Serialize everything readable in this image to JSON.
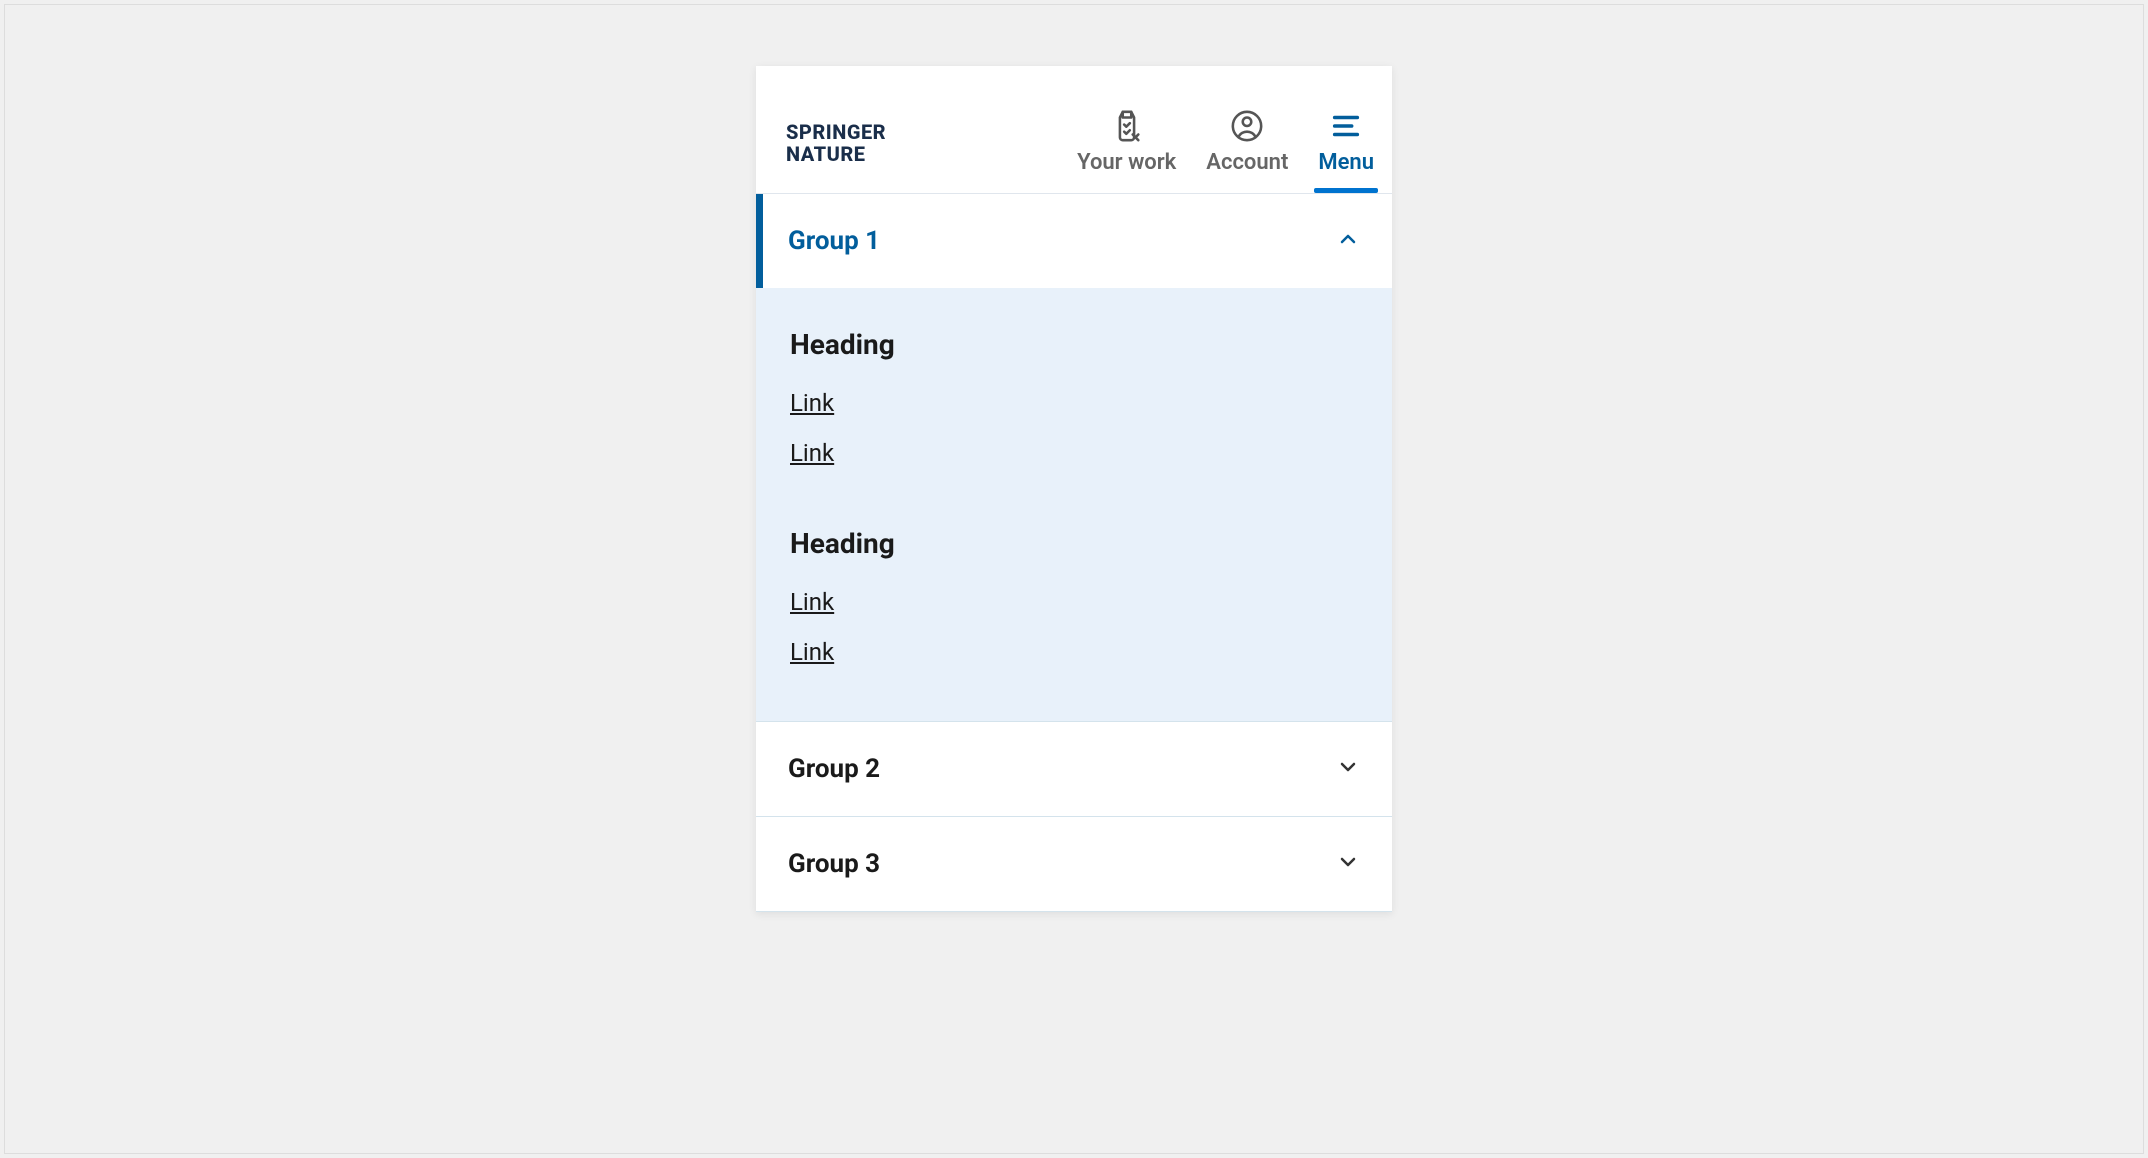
{
  "brand": {
    "line1": "Springer",
    "line2": "Nature"
  },
  "header": {
    "items": [
      {
        "label": "Your work",
        "icon": "clipboard-icon",
        "active": false
      },
      {
        "label": "Account",
        "icon": "account-icon",
        "active": false
      },
      {
        "label": "Menu",
        "icon": "menu-icon",
        "active": true
      }
    ]
  },
  "colors": {
    "brand": "#025e9c",
    "panel": "#e8f1fa",
    "text": "#1a1a1a"
  },
  "menu": {
    "groups": [
      {
        "title": "Group 1",
        "expanded": true,
        "sections": [
          {
            "heading": "Heading",
            "links": [
              "Link",
              "Link"
            ]
          },
          {
            "heading": "Heading",
            "links": [
              "Link",
              "Link"
            ]
          }
        ]
      },
      {
        "title": "Group 2",
        "expanded": false,
        "sections": []
      },
      {
        "title": "Group 3",
        "expanded": false,
        "sections": []
      }
    ]
  }
}
